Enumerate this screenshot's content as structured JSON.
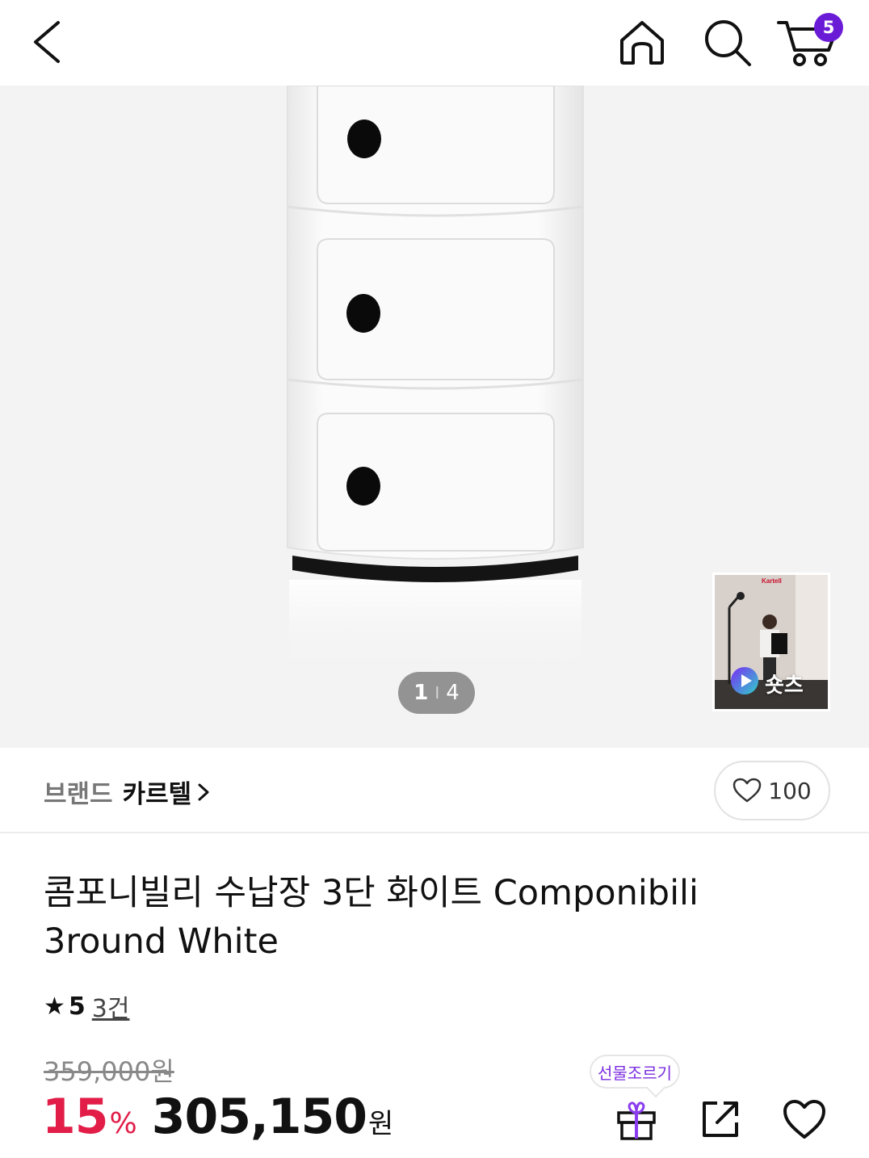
{
  "header": {
    "cart_count": "5"
  },
  "gallery": {
    "current": "1",
    "separator": "I",
    "total": "4",
    "shorts_label": "숏츠",
    "shorts_logo": "Kartell"
  },
  "brand": {
    "prefix": "브랜드",
    "name": "카르텔",
    "like_count": "100"
  },
  "product": {
    "title": "콤포니빌리 수납장 3단 화이트 Componibili 3round White",
    "rating": "5",
    "review_count": "3건"
  },
  "price": {
    "original": "359,000원",
    "discount": "15",
    "discount_unit": "%",
    "sale": "305,150",
    "sale_unit": "원"
  },
  "actions": {
    "gift_label": "선물조르기"
  },
  "colors": {
    "accent": "#e11d48",
    "badge": "#6a1bd6",
    "gift": "#7b2ee0"
  }
}
